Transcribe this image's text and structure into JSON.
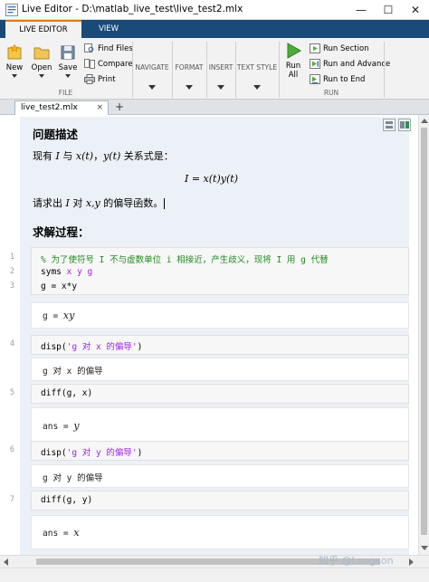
{
  "window": {
    "title": "Live Editor - D:\\matlab_live_test\\live_test2.mlx",
    "minimize": "—",
    "maximize": "☐",
    "close": "✕"
  },
  "ribbon": {
    "tabs": [
      "LIVE EDITOR",
      "VIEW"
    ],
    "file": {
      "new_label": "New",
      "open_label": "Open",
      "save_label": "Save",
      "find_files_label": "Find Files",
      "compare_label": "Compare",
      "print_label": "Print",
      "group_label": "FILE"
    },
    "navigate_label": "NAVIGATE",
    "format_label": "FORMAT",
    "insert_label": "INSERT",
    "text_style_label": "TEXT STYLE",
    "run": {
      "run_all_label_1": "Run",
      "run_all_label_2": "All",
      "run_section_label": "Run Section",
      "run_advance_label": "Run and Advance",
      "run_to_end_label": "Run to End",
      "group_label": "RUN"
    }
  },
  "doc_tab": {
    "name": "live_test2.mlx",
    "close": "×",
    "add": "+"
  },
  "document": {
    "heading1": "问题描述",
    "intro_prefix": "现有",
    "intro_I": "I",
    "intro_with": "与",
    "intro_xt": "x(t)",
    "intro_comma": "，",
    "intro_yt": "y(t)",
    "intro_suffix": "关系式是：",
    "equation": "I = x(t)y(t)",
    "ask_prefix": "请求出",
    "ask_I": "I",
    "ask_to": "对",
    "ask_xy": "x,y",
    "ask_suffix": "的偏导函数。",
    "heading2": "求解过程：",
    "line_numbers": [
      "1",
      "2",
      "3",
      "4",
      "5",
      "6",
      "7"
    ],
    "code1": {
      "comment": "% 为了使符号 I 不与虚数单位 i 相接近，产生歧义，现将 I 用 g 代替",
      "syms": "syms",
      "syms_args": "x y g",
      "assign": "g = x*y"
    },
    "out1": {
      "prefix": "g = ",
      "value": "xy"
    },
    "code2": {
      "fn": "disp(",
      "str": "'g 对 x 的偏导'",
      "close": ")"
    },
    "out2": {
      "text": "g 对 x 的偏导"
    },
    "code3": {
      "text": "diff(g, x)"
    },
    "out3": {
      "prefix": "ans = ",
      "value": "y"
    },
    "code4": {
      "fn": "disp(",
      "str": "'g 对 y 的偏导'",
      "close": ")"
    },
    "out4": {
      "text": "g 对 y 的偏导"
    },
    "code5": {
      "text": "diff(g, y)"
    },
    "out5": {
      "prefix": "ans = ",
      "value": "x"
    }
  },
  "watermark": "知乎 @Longson",
  "colors": {
    "ribbon_tab_bar": "#1a4a78",
    "active_tab_accent": "#e07b16",
    "doc_background": "#ecf1f7",
    "comment_green": "#228b22",
    "string_purple": "#a020f0"
  }
}
